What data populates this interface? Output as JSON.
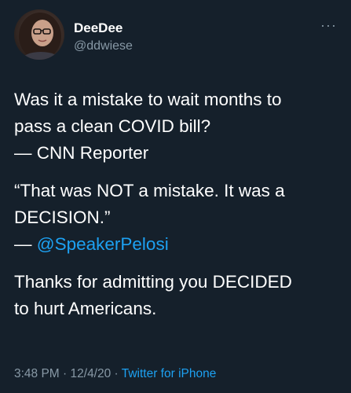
{
  "author": {
    "display_name": "DeeDee",
    "handle": "@ddwiese",
    "more_icon": "more-horizontal-icon"
  },
  "tweet": {
    "paragraph1": {
      "line1": "Was it a mistake to wait months to",
      "line2": "pass a clean COVID bill?",
      "line3": "— CNN Reporter"
    },
    "paragraph2": {
      "line1": "“That was NOT a mistake. It was a",
      "line2": "DECISION.”",
      "line3_prefix": "— ",
      "mention": "@SpeakerPelosi"
    },
    "paragraph3": {
      "line1": "Thanks for admitting you DECIDED",
      "line2": "to hurt Americans."
    }
  },
  "meta": {
    "time": "3:48 PM",
    "date": "12/4/20",
    "separator": " · ",
    "source": "Twitter for iPhone"
  },
  "colors": {
    "background": "#15202b",
    "text": "#ffffff",
    "secondary": "#8899a6",
    "accent": "#1da1f2"
  }
}
